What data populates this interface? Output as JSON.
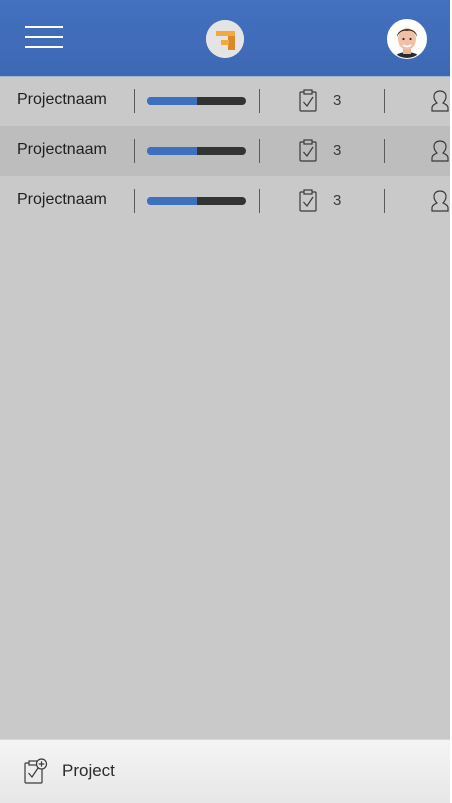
{
  "header": {
    "menu_icon": "hamburger-menu-icon",
    "logo_icon": "app-logo",
    "avatar_icon": "user-avatar",
    "brand_color": "#4371c0"
  },
  "projects": [
    {
      "name": "Projectnaam",
      "progress": 0.5,
      "tasks": "3",
      "task_icon": "clipboard-check-icon",
      "member_icon": "person-icon"
    },
    {
      "name": "Projectnaam",
      "progress": 0.5,
      "tasks": "3",
      "task_icon": "clipboard-check-icon",
      "member_icon": "person-icon"
    },
    {
      "name": "Projectnaam",
      "progress": 0.5,
      "tasks": "3",
      "task_icon": "clipboard-check-icon",
      "member_icon": "person-icon"
    }
  ],
  "footer": {
    "add_label": "Project",
    "add_icon": "clipboard-add-icon"
  }
}
